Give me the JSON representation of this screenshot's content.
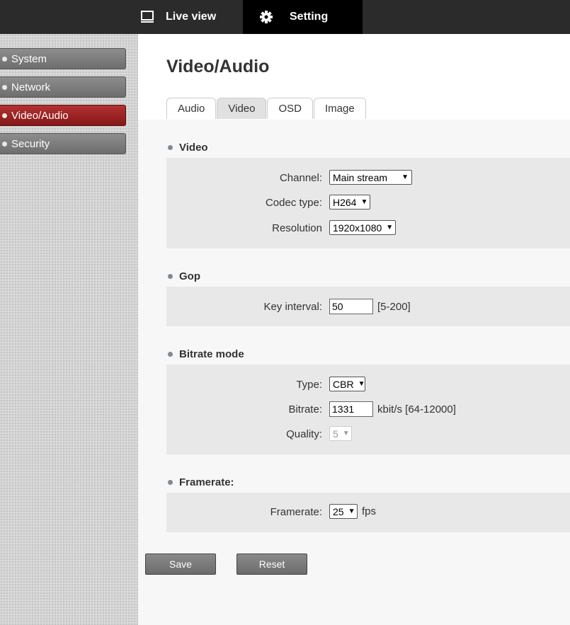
{
  "topnav": {
    "live_view": "Live view",
    "setting": "Setting"
  },
  "sidebar": {
    "items": [
      {
        "label": "System"
      },
      {
        "label": "Network"
      },
      {
        "label": "Video/Audio"
      },
      {
        "label": "Security"
      }
    ]
  },
  "page": {
    "title": "Video/Audio"
  },
  "tabs": [
    {
      "label": "Audio"
    },
    {
      "label": "Video"
    },
    {
      "label": "OSD"
    },
    {
      "label": "Image"
    }
  ],
  "sections": {
    "video": {
      "title": "Video",
      "channel": {
        "label": "Channel:",
        "value": "Main stream"
      },
      "codec": {
        "label": "Codec type:",
        "value": "H264"
      },
      "resolution": {
        "label": "Resolution",
        "value": "1920x1080"
      }
    },
    "gop": {
      "title": "Gop",
      "key_interval": {
        "label": "Key interval:",
        "value": "50",
        "hint": "[5-200]"
      }
    },
    "bitrate": {
      "title": "Bitrate mode",
      "type": {
        "label": "Type:",
        "value": "CBR"
      },
      "bitrate": {
        "label": "Bitrate:",
        "value": "1331",
        "hint": "kbit/s [64-12000]"
      },
      "quality": {
        "label": "Quality:",
        "value": "5"
      }
    },
    "framerate": {
      "title": "Framerate:",
      "framerate": {
        "label": "Framerate:",
        "value": "25",
        "unit": "fps"
      }
    }
  },
  "buttons": {
    "save": "Save",
    "reset": "Reset"
  }
}
